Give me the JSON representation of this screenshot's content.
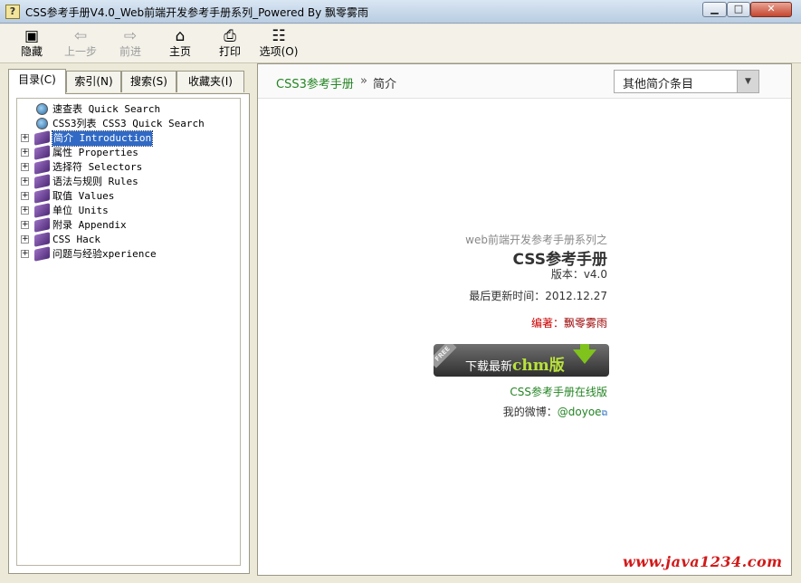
{
  "window": {
    "title": "CSS参考手册V4.0_Web前端开发参考手册系列_Powered By 飘零雾雨",
    "app_icon": "?",
    "controls": {
      "minimize": "▁",
      "maximize": "□",
      "close": "✕"
    }
  },
  "toolbar": {
    "items": [
      {
        "label": "隐藏",
        "icon": "hide-pane-icon",
        "glyph": "▣",
        "enabled": true
      },
      {
        "label": "上一步",
        "icon": "back-arrow-icon",
        "glyph": "⇦",
        "enabled": false
      },
      {
        "label": "前进",
        "icon": "forward-arrow-icon",
        "glyph": "⇨",
        "enabled": false
      },
      {
        "label": "主页",
        "icon": "home-icon",
        "glyph": "⌂",
        "enabled": true
      },
      {
        "label": "打印",
        "icon": "printer-icon",
        "glyph": "⎙",
        "enabled": true
      },
      {
        "label": "选项(O)",
        "icon": "options-icon",
        "glyph": "☷",
        "enabled": true
      }
    ]
  },
  "nav_tabs": [
    {
      "label": "目录(C)",
      "active": true
    },
    {
      "label": "索引(N)",
      "active": false
    },
    {
      "label": "搜索(S)",
      "active": false
    },
    {
      "label": "收藏夹(I)",
      "active": false
    }
  ],
  "tree": [
    {
      "label": "速查表 Quick Search",
      "icon": "globe-page-icon",
      "expandable": false,
      "selected": false
    },
    {
      "label": "CSS3列表 CSS3 Quick Search",
      "icon": "globe-page-icon",
      "expandable": false,
      "selected": false
    },
    {
      "label": "简介 Introduction",
      "icon": "book-icon",
      "expandable": true,
      "selected": true
    },
    {
      "label": "属性 Properties",
      "icon": "book-icon",
      "expandable": true,
      "selected": false
    },
    {
      "label": "选择符 Selectors",
      "icon": "book-icon",
      "expandable": true,
      "selected": false
    },
    {
      "label": "语法与规则 Rules",
      "icon": "book-icon",
      "expandable": true,
      "selected": false
    },
    {
      "label": "取值 Values",
      "icon": "book-icon",
      "expandable": true,
      "selected": false
    },
    {
      "label": "单位 Units",
      "icon": "book-icon",
      "expandable": true,
      "selected": false
    },
    {
      "label": "附录 Appendix",
      "icon": "book-icon",
      "expandable": true,
      "selected": false
    },
    {
      "label": "CSS Hack",
      "icon": "book-icon",
      "expandable": true,
      "selected": false
    },
    {
      "label": "问题与经验xperience",
      "icon": "book-icon",
      "expandable": true,
      "selected": false
    }
  ],
  "content": {
    "breadcrumb": {
      "link": "CSS3参考手册",
      "separator": "»",
      "current": "简介"
    },
    "entry_select": {
      "value": "其他简介条目"
    },
    "series_text": "web前端开发参考手册系列之",
    "book_title": "CSS参考手册",
    "version": "版本：v4.0",
    "last_updated": "最后更新时间：2012.12.27",
    "editor_label": "编著：",
    "editor_name": "飘零雾雨",
    "download": {
      "badge": "FREE",
      "text": "下载最新",
      "highlight": "chm版"
    },
    "online_link": "CSS参考手册在线版",
    "weibo_label": "我的微博：",
    "weibo_handle": "@doyoe"
  },
  "watermark": "www.java1234.com",
  "colors": {
    "link_green": "#248424",
    "selection_blue": "#316ac5",
    "editor_red": "#990000",
    "watermark_red": "#d11a1a",
    "download_accent": "#b9e23b"
  }
}
